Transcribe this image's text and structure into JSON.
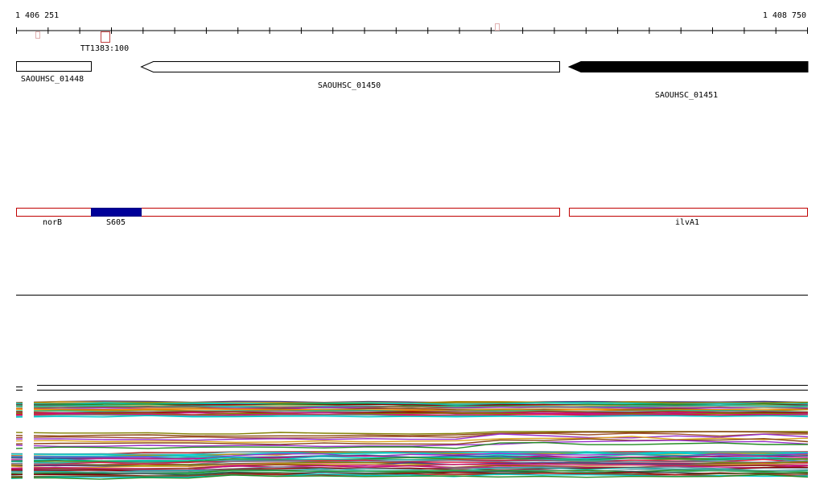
{
  "ruler": {
    "start_label": "1 406 251",
    "end_label": "1 408 750",
    "start": 1406251,
    "end": 1408750
  },
  "annotation_features": [
    {
      "label": "TT1383:100",
      "color": "#c04040"
    }
  ],
  "genes": [
    {
      "id": "SAOUHSC_01448",
      "label": "SAOUHSC_01448",
      "strand": "+",
      "fill": "#ffffff"
    },
    {
      "id": "SAOUHSC_01450",
      "label": "SAOUHSC_01450",
      "strand": "-",
      "fill": "#ffffff"
    },
    {
      "id": "SAOUHSC_01451",
      "label": "SAOUHSC_01451",
      "strand": "-",
      "fill": "#000000"
    }
  ],
  "regions": [
    {
      "label": "norB",
      "stroke": "#c00000",
      "fill": "#ffffff"
    },
    {
      "label": "S605",
      "stroke": "#000080",
      "fill": "#000099"
    },
    {
      "label": "ilvA1",
      "stroke": "#c00000",
      "fill": "#ffffff"
    }
  ],
  "colors": {
    "axis": "#000000",
    "region_outline": "#c00000",
    "srna_fill": "#000099"
  },
  "coverage_track_palette": [
    "#8b0000",
    "#556b2f",
    "#b8860b",
    "#4b0082",
    "#2f4f4f",
    "#cd853f",
    "#708090",
    "#8b4513",
    "#228b22",
    "#daa520",
    "#9932cc",
    "#20b2aa",
    "#dc143c",
    "#6b8e23",
    "#ff8c00",
    "#483d8b",
    "#00ced1",
    "#a0522d",
    "#808000",
    "#c71585",
    "#5f9ea0",
    "#bdb76b",
    "#b22222",
    "#3cb371"
  ]
}
